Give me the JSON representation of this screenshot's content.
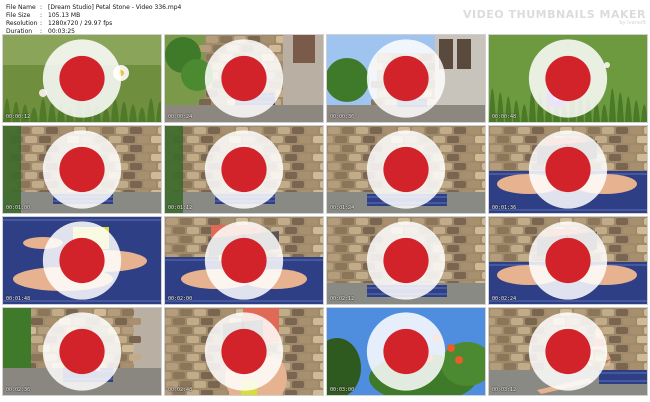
{
  "file_info": [
    {
      "key": "File Name",
      "value": "[Dream Studio] Petal Stone - Video 336.mp4"
    },
    {
      "key": "File Size",
      "value": "105.13 MB"
    },
    {
      "key": "Resolution",
      "value": "1280x720 / 29.97 fps"
    },
    {
      "key": "Duration",
      "value": "00:03:25"
    }
  ],
  "separator": ":",
  "logo": {
    "main": "VIDEO THUMBNAILS MAKER",
    "sub": "by Ivarsoft"
  },
  "thumbnails": [
    {
      "timestamp": "00:00:12",
      "scene": "flowers-white"
    },
    {
      "timestamp": "00:00:24",
      "scene": "wall-wide"
    },
    {
      "timestamp": "00:00:36",
      "scene": "wall-sky"
    },
    {
      "timestamp": "00:00:48",
      "scene": "flower-purple"
    },
    {
      "timestamp": "00:01:00",
      "scene": "girl-knees"
    },
    {
      "timestamp": "00:01:12",
      "scene": "girl-knees"
    },
    {
      "timestamp": "00:01:24",
      "scene": "girl-reading"
    },
    {
      "timestamp": "00:01:36",
      "scene": "closeup-book"
    },
    {
      "timestamp": "00:01:48",
      "scene": "closeup-legs"
    },
    {
      "timestamp": "00:02:00",
      "scene": "closeup-book2"
    },
    {
      "timestamp": "00:02:12",
      "scene": "girl-reading"
    },
    {
      "timestamp": "00:02:24",
      "scene": "closeup-book"
    },
    {
      "timestamp": "00:02:36",
      "scene": "girl-corner"
    },
    {
      "timestamp": "00:02:48",
      "scene": "closeup-torso"
    },
    {
      "timestamp": "00:03:00",
      "scene": "flowers-red"
    },
    {
      "timestamp": "00:03:12",
      "scene": "girl-sitting-right"
    }
  ],
  "colors": {
    "stone": "#a08a6c",
    "blanket": "#2f3f86",
    "sky": "#5b8fd6",
    "foliage": "#4d7a2e",
    "skin": "#e6b28f",
    "top": "#e06a55",
    "shorts": "#d9dc3d"
  }
}
